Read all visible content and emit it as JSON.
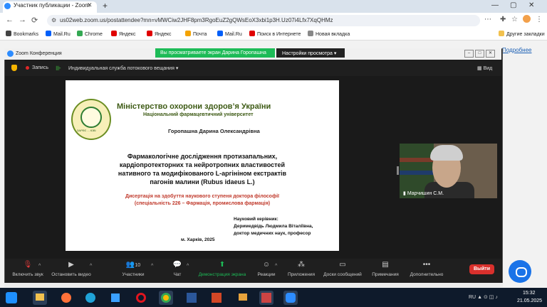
{
  "browser": {
    "tab_title": "Участник публикации - Zoom",
    "tab_close": "✕",
    "new_tab": "+",
    "url": "us02web.zoom.us/postattendee?mn=vMWCiw2JHF8pm3RgoEuZ2gQWsEoX3xbi1p3H.Uz07i4Lfx7XqQHMz",
    "window_controls": [
      "—",
      "▢",
      "✕"
    ],
    "nav": [
      "←",
      "→",
      "⟳"
    ],
    "bookmarks": [
      {
        "label": "Bookmarks",
        "color": "#444444",
        "icon": "star-icon"
      },
      {
        "label": "Mail.Ru",
        "color": "#005ff9",
        "icon": "mailru-icon"
      },
      {
        "label": "Chrome",
        "color": "#34a853",
        "icon": "chrome-icon"
      },
      {
        "label": "Яндекс",
        "color": "#e00000",
        "icon": "yandex-icon"
      },
      {
        "label": "Яндекс",
        "color": "#e00000",
        "icon": "yandex-icon"
      },
      {
        "label": "Почта",
        "color": "#f4a300",
        "icon": "mail-icon"
      },
      {
        "label": "Mail.Ru",
        "color": "#005ff9",
        "icon": "mailru-icon"
      },
      {
        "label": "Поиск в Интернете",
        "color": "#e00000",
        "icon": "search-icon"
      },
      {
        "label": "Новая вкладка",
        "color": "#888888",
        "icon": "new-tab-icon"
      }
    ],
    "other_bookmarks": "Другие закладки"
  },
  "page": {
    "link_text": "Подробнее"
  },
  "zoom": {
    "window_title": "Zoom Конференция",
    "share_banner": "Вы просматриваете экран Дарина Горопашна",
    "view_settings": "Настройки просмотра",
    "recording_label": "Запись",
    "stream_label": "Индивидуальная служба потокового вещания",
    "view_button": "Вид",
    "participant_name": "Марчишин С.М.",
    "toolbar": {
      "mute": "Включить звук",
      "video": "Остановить видео",
      "participants": "Участники",
      "participants_count": "10",
      "chat": "Чат",
      "share": "Демонстрация экрана",
      "reactions": "Реакции",
      "apps": "Приложения",
      "whiteboard": "Доски сообщений",
      "notes": "Примечания",
      "more": "Дополнительно",
      "leave": "Выйти"
    },
    "colors": {
      "share_green": "#1dbb57",
      "leave_red": "#d9302c",
      "toolbar_bg": "#1f1f1f"
    }
  },
  "slide": {
    "ministry": "Міністерство охорони здоров’я України",
    "university": "Національний фармацевтичний університет",
    "logo_text": "ЗАРЕЄ ... ЮВІ",
    "author": "Горопашна Дарина Олександрівна",
    "title_lines": [
      "Фармакологічне дослідження протизапальних,",
      "кардіопротекторних та нейротропних властивостей",
      "нативного та модифікованого L-аргініном екстрактів",
      "пагонів малини (Rubus idaeus L.)"
    ],
    "degree_lines": [
      "Дисертація на здобуття наукового ступеня доктора філософії",
      "(спеціальність 226 – Фармація, промислова фармація)"
    ],
    "supervisor_lines": [
      "Науковий керівник:",
      "Деримедвідь Людмила Віталіївна,",
      "доктор медичних наук, професор"
    ],
    "city_year": "м. Харків, 2025"
  },
  "taskbar": {
    "tray": "RU",
    "time": "15:32",
    "date": "21.05.2025",
    "apps": [
      "start",
      "file-explorer",
      "firefox",
      "edge",
      "windows",
      "opera",
      "chrome",
      "word",
      "powerpoint",
      "zoom"
    ]
  }
}
